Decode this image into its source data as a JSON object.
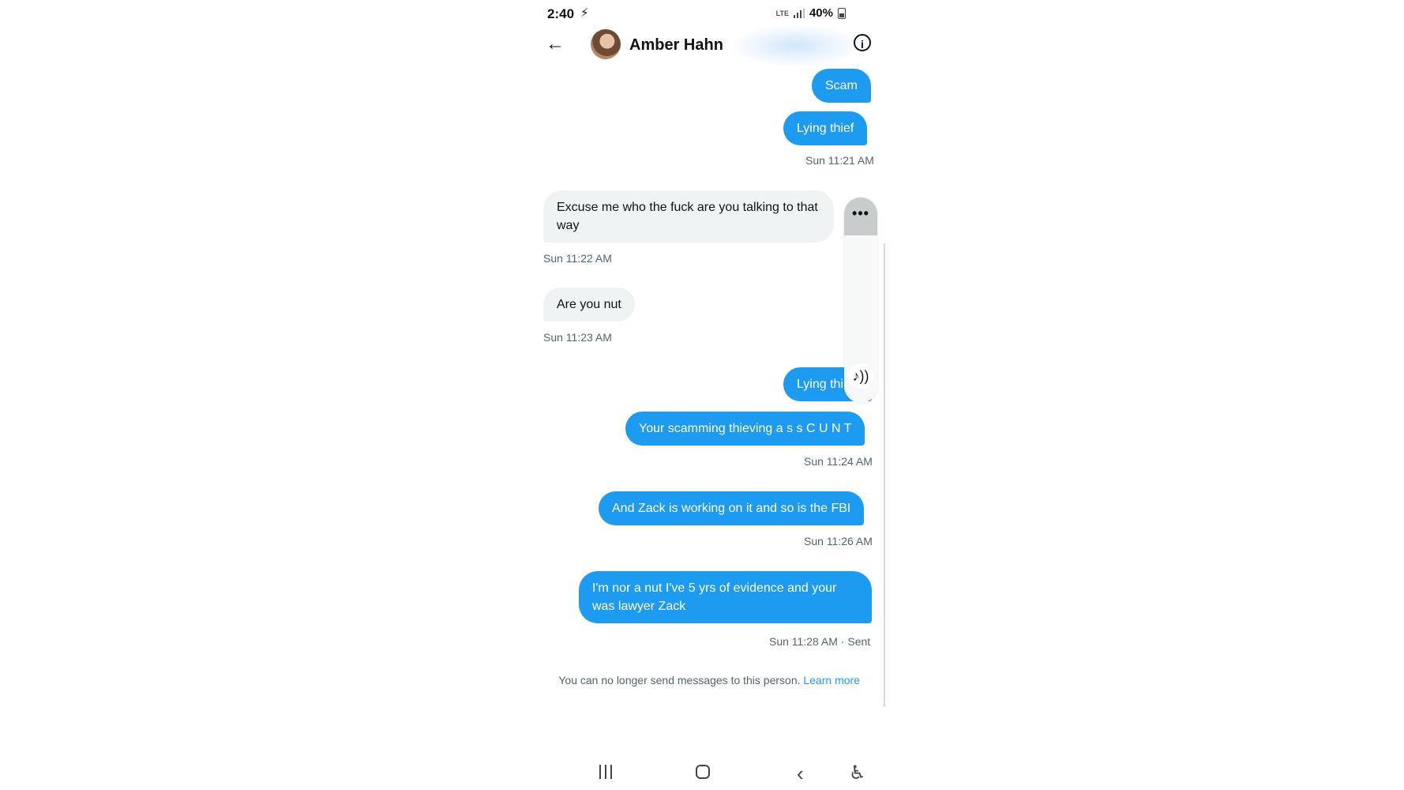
{
  "status_bar": {
    "time": "2:40",
    "network": "LTE",
    "battery": "40%"
  },
  "header": {
    "contact_name": "Amber Hahn"
  },
  "messages": [
    {
      "text": "Scam",
      "direction": "sent"
    },
    {
      "text": "Lying thief",
      "direction": "sent"
    },
    {
      "timestamp": "Sun 11:21 AM"
    },
    {
      "text": "Excuse me who the fuck are you talking to that way",
      "direction": "received"
    },
    {
      "timestamp": "Sun 11:22 AM"
    },
    {
      "text": "Are you nut",
      "direction": "received"
    },
    {
      "timestamp": "Sun 11:23 AM"
    },
    {
      "text": "Lying thi",
      "direction": "sent"
    },
    {
      "text": "Your  scamming thieving a s s C U N T",
      "direction": "sent"
    },
    {
      "timestamp": "Sun 11:24 AM"
    },
    {
      "text": "And Zack is working on it and so is the FBI",
      "direction": "sent"
    },
    {
      "timestamp": "Sun 11:26 AM"
    },
    {
      "text": "I'm nor a nut I've  5 yrs of evidence and your was lawyer Zack",
      "direction": "sent"
    },
    {
      "timestamp": "Sun 11:28 AM · Sent"
    }
  ],
  "notice": {
    "text": "You can no longer send messages to this person.",
    "link": "Learn more"
  },
  "toolbar": {
    "more_label": "•••",
    "tts_label": "♪))"
  },
  "icons": {
    "back": "arrow-left-icon",
    "info": "info-icon",
    "recents": "recents-icon",
    "home": "home-icon",
    "nav_back": "nav-back-icon",
    "accessibility": "accessibility-icon"
  },
  "colors": {
    "sent_bubble": "#1d9bf0",
    "received_bubble": "#eff3f4",
    "link": "#1d9bf0",
    "timestamp": "#536471"
  }
}
